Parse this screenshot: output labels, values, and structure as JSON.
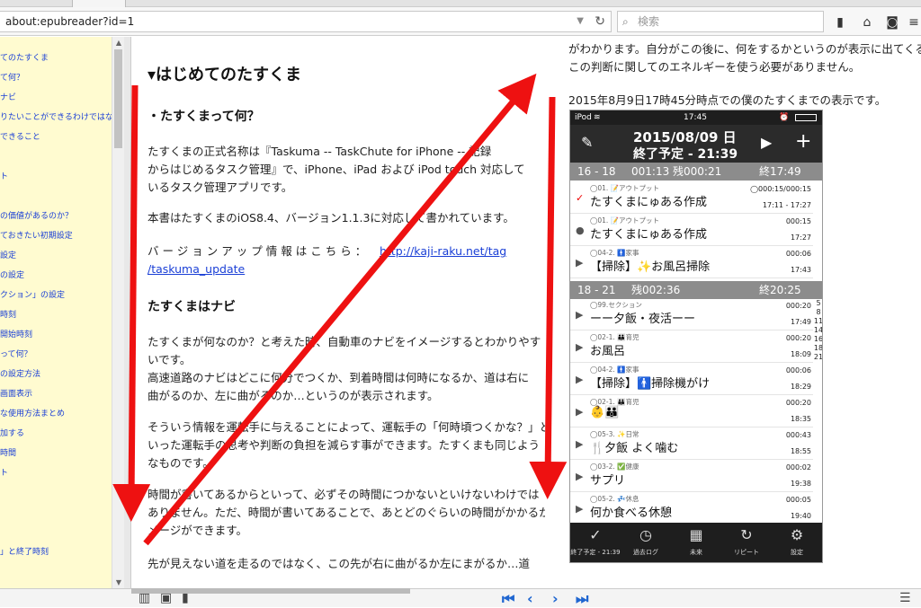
{
  "browser": {
    "url": "about:epubreader?id=1",
    "search_placeholder": "検索",
    "icons": [
      "bookmark-icon",
      "home-icon",
      "pocket-icon",
      "menu-icon"
    ]
  },
  "sidebar": {
    "items": [
      "てのたすくま",
      "て何？",
      "ナビ",
      "りたいことができるわけではない",
      "できること",
      "ト",
      "の価値があるのか？",
      "ておきたい初期設定",
      "設定",
      "の設定",
      "クション」の設定",
      "時刻",
      "開始時刻",
      "って何？",
      "の設定方法",
      "画面表示",
      "な使用方法まとめ",
      "加する",
      "時間",
      "ト",
      "」と終了時刻"
    ]
  },
  "left_page": {
    "h1": "▾はじめてのたすくま",
    "h2a": "・たすくまって何？",
    "p1": [
      "たすくまの正式名称は『Taskuma -- TaskChute for iPhone -- 記録",
      "からはじめるタスク管理』で、iPhone、iPad および iPod touch 対応して",
      "いるタスク管理アプリです。"
    ],
    "p2": "本書はたすくまのiOS8.4、バージョン1.1.3に対応して書かれています。",
    "p3_label": "バージョンアップ情報はこちら：",
    "p3_link1": "http://kaji-raku.net/tag",
    "p3_link2": "/taskuma_update",
    "h2b": "たすくまはナビ",
    "p4": [
      "たすくまが何なのか？と考えた時、自動車のナビをイメージするとわかりやす",
      "いです。",
      "高速道路のナビはどこに何分でつくか、到着時間は何時になるか、道は右に",
      "曲がるのか、左に曲がるのか…というのが表示されます。"
    ],
    "p5": [
      "そういう情報を運転手に与えることによって、運転手の「何時頃つくかな？」と",
      "いった運転手の思考や判断の負担を減らす事ができます。たすくまも同じよう",
      "なものです。"
    ],
    "p6": [
      "時間が書いてあるからといって、必ずその時間につかないといけないわけでは",
      "ありません。ただ、時間が書いてあることで、あとどのぐらいの時間がかかるかイ",
      "メージができます。"
    ],
    "p7": "先が見えない道を走るのではなく、この先が右に曲がるか左にまがるか…道"
  },
  "right_page": {
    "p1": [
      "がわかります。自分がこの後に、何をするかというのが表示に出てくるの",
      "この判断に関してのエネルギーを使う必要がありません。"
    ],
    "p2": "2015年8月9日17時45分時点での僕のたすくまでの表示です。"
  },
  "phone": {
    "status_left": "iPod",
    "status_time": "17:45",
    "date": "2015/08/09 日",
    "end": "終了予定 - 21:39",
    "sec1": {
      "range": "16 - 18",
      "info": "001:13 残000:21",
      "end": "終17:49"
    },
    "sec2": {
      "range": "18 - 21",
      "info": "残002:36",
      "end": "終20:25"
    },
    "tasks": [
      {
        "cat": "◯01. 📝アウトプット",
        "name": "たすくまにゅある作成",
        "mark": "✓",
        "t1": "◯000:15/000:15",
        "t2": "17:11 - 17:27"
      },
      {
        "cat": "◯01. 📝アウトプット",
        "name": "たすくまにゅある作成",
        "mark": "●",
        "t1": "000:15",
        "t2": "17:27"
      },
      {
        "cat": "◯04-2. 🚹家事",
        "name": "【掃除】✨お風呂掃除",
        "mark": "▶",
        "t1": "000:06",
        "t2": "17:43"
      },
      {
        "cat": "◯99.セクション",
        "name": "ーー夕飯・夜活ーー",
        "mark": "▶",
        "t1": "000:20",
        "t2": "17:49"
      },
      {
        "cat": "◯02-1. 👪育児",
        "name": "お風呂",
        "mark": "▶",
        "t1": "000:20",
        "t2": "18:09"
      },
      {
        "cat": "◯04-2. 🚹家事",
        "name": "【掃除】🚹掃除機がけ",
        "mark": "▶",
        "t1": "000:06",
        "t2": "18:29"
      },
      {
        "cat": "◯02-1. 👪育児",
        "name": "👶👪",
        "mark": "▶",
        "t1": "000:20",
        "t2": "18:35"
      },
      {
        "cat": "◯05-3. ✨日常",
        "name": "🍴夕飯 よく噛む",
        "mark": "▶",
        "t1": "000:43",
        "t2": "18:55"
      },
      {
        "cat": "◯03-2. ✅健康",
        "name": "サプリ",
        "mark": "▶",
        "t1": "000:02",
        "t2": "19:38"
      },
      {
        "cat": "◯05-2. 💤休息",
        "name": "何か食べる休憩",
        "mark": "▶",
        "t1": "000:05",
        "t2": "19:40"
      }
    ],
    "side_index": [
      "5",
      "8",
      "11",
      "14",
      "16",
      "18",
      "21"
    ],
    "tabs": [
      {
        "icon": "✓",
        "label": "終了予定 - 21:39"
      },
      {
        "icon": "◷",
        "label": "過去ログ"
      },
      {
        "icon": "▦",
        "label": "未来"
      },
      {
        "icon": "↻",
        "label": "リピート"
      },
      {
        "icon": "⚙",
        "label": "設定"
      }
    ]
  },
  "bottom": {
    "nav": [
      "⏮",
      "‹",
      "›",
      "⏭"
    ]
  },
  "colors": {
    "sidebar_bg": "#fffbd0",
    "link": "#1a3fd6",
    "arrow": "#ee1111"
  }
}
